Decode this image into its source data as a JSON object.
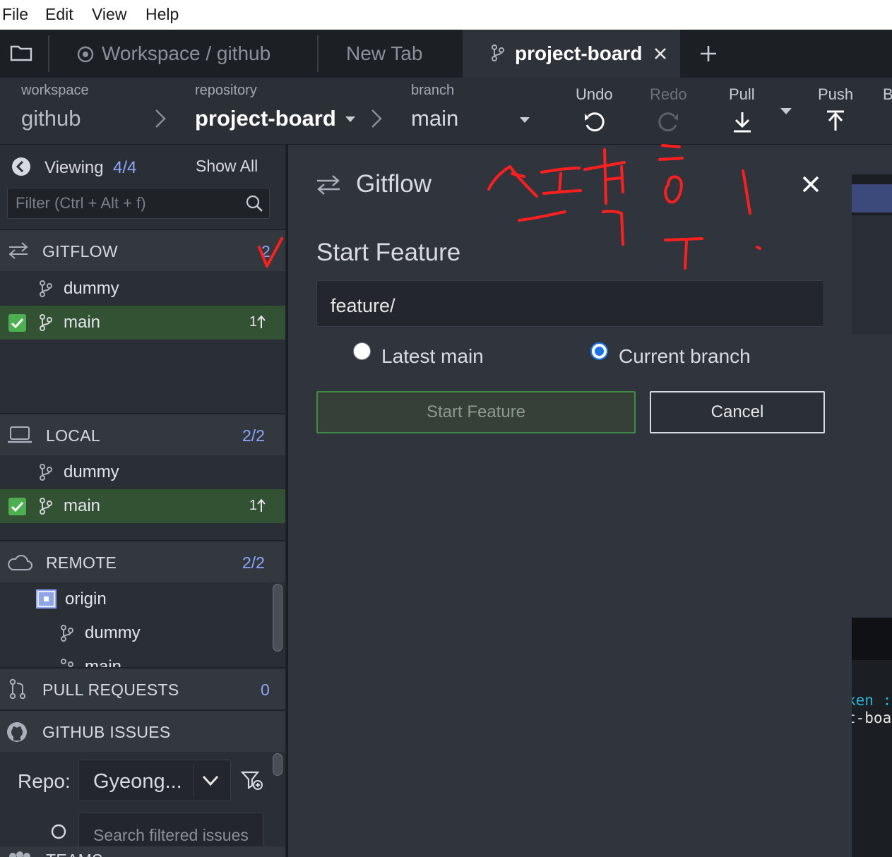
{
  "menu": [
    "File",
    "Edit",
    "View",
    "Help"
  ],
  "tabs": {
    "workspace_tab": "Workspace / github",
    "new_tab": "New Tab",
    "active_tab": "project-board"
  },
  "toolbar": {
    "workspace_label": "workspace",
    "workspace_value": "github",
    "repository_label": "repository",
    "repository_value": "project-board",
    "branch_label": "branch",
    "branch_value": "main",
    "undo": "Undo",
    "redo": "Redo",
    "pull": "Pull",
    "push": "Push",
    "cut_off": "B"
  },
  "sidebar": {
    "viewing_label": "Viewing",
    "viewing_count": "4/4",
    "show_all": "Show All",
    "filter_placeholder": "Filter (Ctrl + Alt + f)",
    "gitflow": {
      "title": "GITFLOW",
      "count": "2",
      "branches": [
        "dummy",
        "main"
      ],
      "ahead": "1"
    },
    "local": {
      "title": "LOCAL",
      "count": "2/2",
      "branches": [
        "dummy",
        "main"
      ],
      "ahead": "1"
    },
    "remote": {
      "title": "REMOTE",
      "count": "2/2",
      "origin": "origin",
      "branches": [
        "dummy",
        "main"
      ]
    },
    "pull_requests": {
      "title": "PULL REQUESTS",
      "count": "0"
    },
    "github_issues": {
      "title": "GITHUB ISSUES",
      "repo_label": "Repo:",
      "repo_value": "Gyeong...",
      "search_placeholder": "Search filtered issues"
    },
    "teams": {
      "title": "TEAMS"
    }
  },
  "dialog": {
    "title": "Gitflow",
    "heading": "Start Feature",
    "input_value": "feature/",
    "radio_latest": "Latest main",
    "radio_current": "Current branch",
    "start_button": "Start Feature",
    "cancel_button": "Cancel"
  },
  "background_code": [
    "ken :",
    "t-boar"
  ],
  "colors": {
    "accent": "#8fa6ff",
    "selected_row": "#335234",
    "annotation": "#ff1f1f",
    "check": "#4caf50"
  }
}
